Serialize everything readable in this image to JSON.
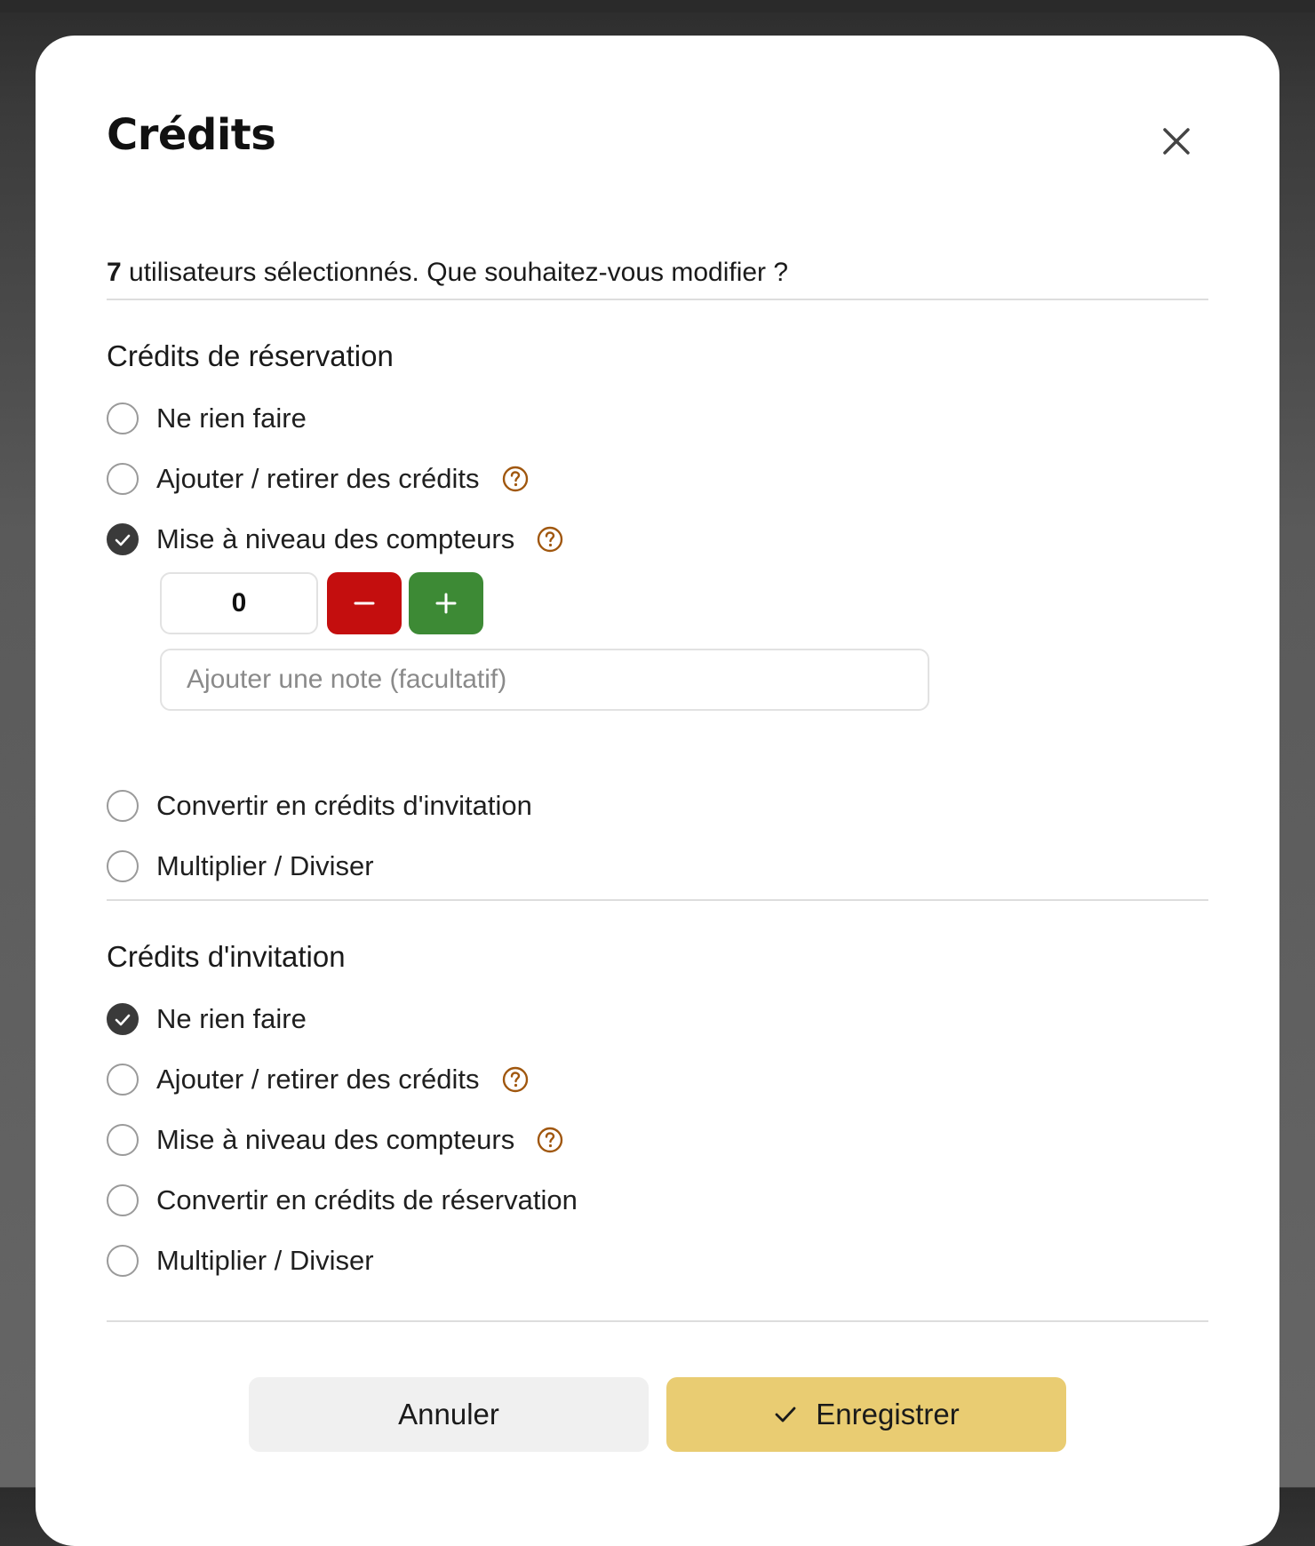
{
  "modal": {
    "title": "Crédits",
    "close_icon": "close-icon",
    "subtitle_count": "7",
    "subtitle_text": " utilisateurs sélectionnés. Que souhaitez-vous modifier ?"
  },
  "reservation": {
    "title": "Crédits de réservation",
    "options": [
      {
        "label": "Ne rien faire",
        "checked": false,
        "help": false
      },
      {
        "label": "Ajouter / retirer des crédits",
        "checked": false,
        "help": true
      },
      {
        "label": "Mise à niveau des compteurs",
        "checked": true,
        "help": true
      },
      {
        "label": "Convertir en crédits d'invitation",
        "checked": false,
        "help": false
      },
      {
        "label": "Multiplier / Diviser",
        "checked": false,
        "help": false
      }
    ],
    "counter_value": "0",
    "minus_icon": "minus-icon",
    "plus_icon": "plus-icon",
    "note_placeholder": "Ajouter une note (facultatif)"
  },
  "invitation": {
    "title": "Crédits d'invitation",
    "options": [
      {
        "label": "Ne rien faire",
        "checked": true,
        "help": false
      },
      {
        "label": "Ajouter / retirer des crédits",
        "checked": false,
        "help": true
      },
      {
        "label": "Mise à niveau des compteurs",
        "checked": false,
        "help": true
      },
      {
        "label": "Convertir en crédits de réservation",
        "checked": false,
        "help": false
      },
      {
        "label": "Multiplier / Diviser",
        "checked": false,
        "help": false
      }
    ]
  },
  "footer": {
    "cancel_label": "Annuler",
    "save_label": "Enregistrer"
  },
  "colors": {
    "accent": "#e9cc72",
    "help_icon": "#a0570e",
    "minus_button": "#c40e0e",
    "plus_button": "#3d8a35",
    "checked_radio": "#3a3a3a"
  }
}
